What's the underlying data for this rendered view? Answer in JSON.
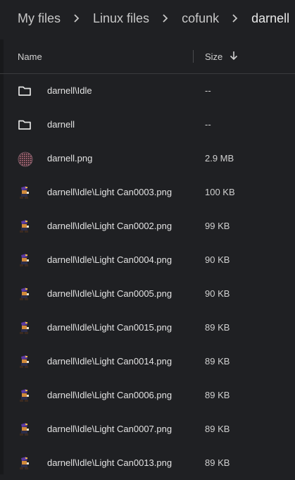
{
  "breadcrumb": [
    "My files",
    "Linux files",
    "cofunk",
    "darnell"
  ],
  "header": {
    "name": "Name",
    "size": "Size",
    "sort_icon": "arrow-down-icon"
  },
  "files": [
    {
      "name": "darnell\\Idle",
      "size": "--",
      "icon": "folder-icon"
    },
    {
      "name": "darnell",
      "size": "--",
      "icon": "folder-icon"
    },
    {
      "name": "darnell.png",
      "size": "2.9 MB",
      "icon": "image-thumbnail-icon"
    },
    {
      "name": "darnell\\Idle\\Light Can0003.png",
      "size": "100 KB",
      "icon": "sprite-thumbnail-icon"
    },
    {
      "name": "darnell\\Idle\\Light Can0002.png",
      "size": "99 KB",
      "icon": "sprite-thumbnail-icon"
    },
    {
      "name": "darnell\\Idle\\Light Can0004.png",
      "size": "90 KB",
      "icon": "sprite-thumbnail-icon"
    },
    {
      "name": "darnell\\Idle\\Light Can0005.png",
      "size": "90 KB",
      "icon": "sprite-thumbnail-icon"
    },
    {
      "name": "darnell\\Idle\\Light Can0015.png",
      "size": "89 KB",
      "icon": "sprite-thumbnail-icon"
    },
    {
      "name": "darnell\\Idle\\Light Can0014.png",
      "size": "89 KB",
      "icon": "sprite-thumbnail-icon"
    },
    {
      "name": "darnell\\Idle\\Light Can0006.png",
      "size": "89 KB",
      "icon": "sprite-thumbnail-icon"
    },
    {
      "name": "darnell\\Idle\\Light Can0007.png",
      "size": "89 KB",
      "icon": "sprite-thumbnail-icon"
    },
    {
      "name": "darnell\\Idle\\Light Can0013.png",
      "size": "89 KB",
      "icon": "sprite-thumbnail-icon"
    }
  ],
  "colors": {
    "background": "#1f2023",
    "text": "#e3e3e3",
    "muted": "#c7c7c7"
  }
}
